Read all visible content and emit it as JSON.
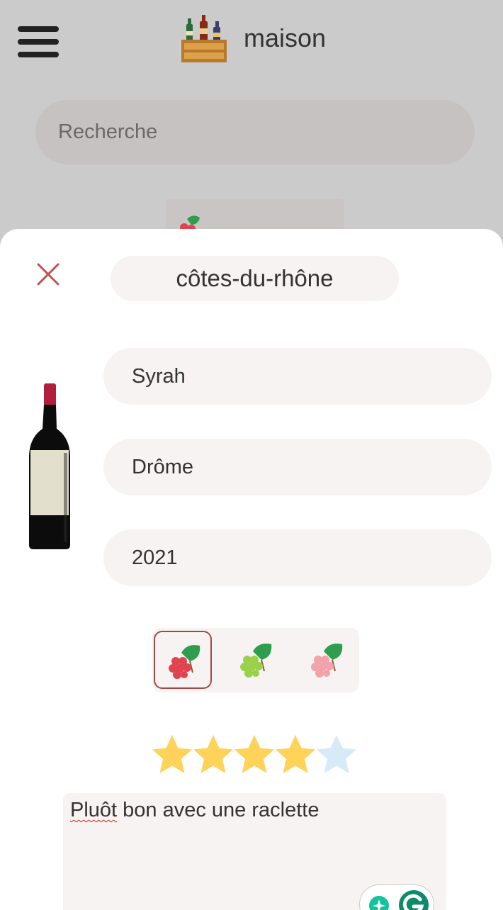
{
  "header": {
    "app_title": "maison",
    "menu_icon": "hamburger-menu-icon",
    "logo_icon": "wine-crate-logo"
  },
  "search": {
    "placeholder": "Recherche"
  },
  "sheet": {
    "close_icon": "close-icon",
    "wine_name": "côtes-du-rhône",
    "bottle_icon": "red-wine-bottle-icon",
    "fields": {
      "grape": "Syrah",
      "region": "Drôme",
      "vintage": "2021"
    },
    "color_options": [
      {
        "icon": "red-grape-icon",
        "selected": true,
        "color": "#e0444e"
      },
      {
        "icon": "white-grape-icon",
        "selected": false,
        "color": "#9ad14a"
      },
      {
        "icon": "rose-grape-icon",
        "selected": false,
        "color": "#f2a2aa"
      }
    ],
    "rating": {
      "value": 4,
      "max": 5,
      "filled_color": "#ffd35a",
      "empty_color": "#d7eaf7"
    },
    "comment": {
      "misspelled_word": "Pluôt",
      "rest": " bon avec une raclette"
    },
    "grammarly_icon": "grammarly-icon"
  },
  "colors": {
    "close": "#c0524e",
    "selected_border": "#a04a45",
    "field_bg": "#f6f3f2"
  }
}
